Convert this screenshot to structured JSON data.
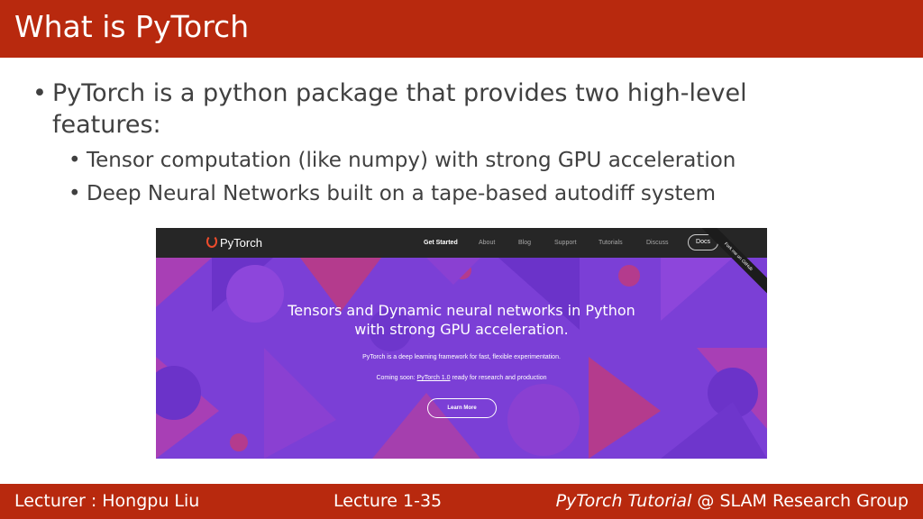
{
  "slide": {
    "title": "What is PyTorch",
    "bullets": {
      "main": "PyTorch is a python package that provides two high-level features:",
      "sub": [
        "Tensor computation (like numpy) with strong GPU acceleration",
        "Deep Neural Networks built on a tape-based autodiff system"
      ],
      "bullet_glyph": "•"
    }
  },
  "screenshot": {
    "logo": "PyTorch",
    "nav": [
      "Get Started",
      "About",
      "Blog",
      "Support",
      "Tutorials",
      "Discuss"
    ],
    "docs_button": "Docs",
    "ribbon": "Fork me on GitHub",
    "hero": {
      "heading_line1": "Tensors and Dynamic neural networks in Python",
      "heading_line2": "with strong GPU acceleration.",
      "desc": "PyTorch is a deep learning framework for fast, flexible experimentation.",
      "coming_prefix": "Coming soon: ",
      "coming_link": "PyTorch 1.0",
      "coming_suffix": " ready for research and production",
      "button": "Learn More"
    },
    "colors": {
      "nav_bg": "#262626",
      "hero_purple": "#7b3fd6",
      "hero_magenta": "#b43b8d",
      "accent_flame": "#ee4c2c"
    }
  },
  "footer": {
    "lecturer": "Lecturer : Hongpu Liu",
    "lecture": "Lecture 1-35",
    "course_italic": "PyTorch Tutorial",
    "course_rest": " @ SLAM Research Group"
  },
  "theme": {
    "bar_color": "#b8290e",
    "text_color": "#404040"
  }
}
